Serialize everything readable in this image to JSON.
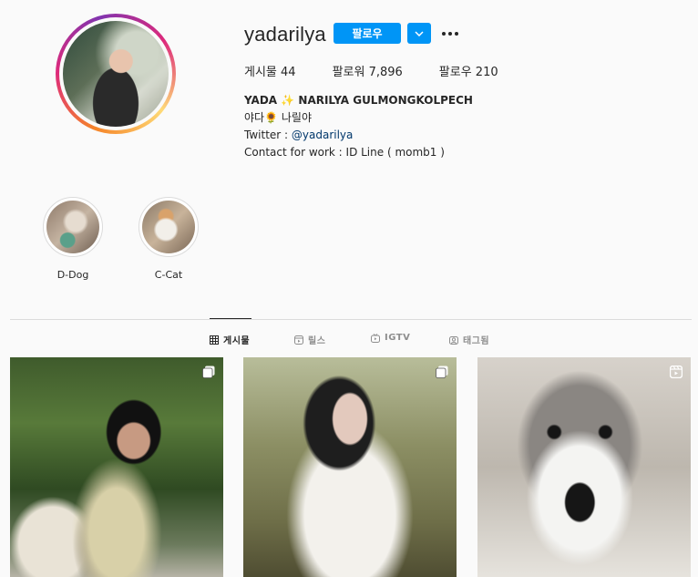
{
  "profile": {
    "username": "yadarilya",
    "follow_label": "팔로우",
    "stats": {
      "posts": "게시물 44",
      "followers": "팔로워 7,896",
      "following": "팔로우 210"
    },
    "bio": {
      "name_pre": "YADA ",
      "name_emoji": "✨",
      "name_post": " NARILYA GULMONGKOLPECH",
      "line2_pre": "야다",
      "line2_emoji": "🌻",
      "line2_post": " 나릴야",
      "twitter_prefix": "Twitter : ",
      "twitter_handle": "@yadarilya",
      "contact": "Contact for work : ID Line ( momb1 )"
    }
  },
  "highlights": [
    {
      "label": "D-Dog"
    },
    {
      "label": "C-Cat"
    }
  ],
  "tabs": [
    {
      "label": "게시물",
      "icon": "grid-icon",
      "active": true
    },
    {
      "label": "릴스",
      "icon": "reels-icon",
      "active": false
    },
    {
      "label": "IGTV",
      "icon": "igtv-icon",
      "active": false
    },
    {
      "label": "태그됨",
      "icon": "tag-icon",
      "active": false
    }
  ],
  "posts": [
    {
      "type": "carousel",
      "badge_icon": "carousel-icon"
    },
    {
      "type": "carousel",
      "badge_icon": "carousel-icon"
    },
    {
      "type": "reel",
      "badge_icon": "reels-icon"
    }
  ],
  "colors": {
    "accent": "#0095f6",
    "link": "#00376b",
    "background": "#fafafa"
  }
}
